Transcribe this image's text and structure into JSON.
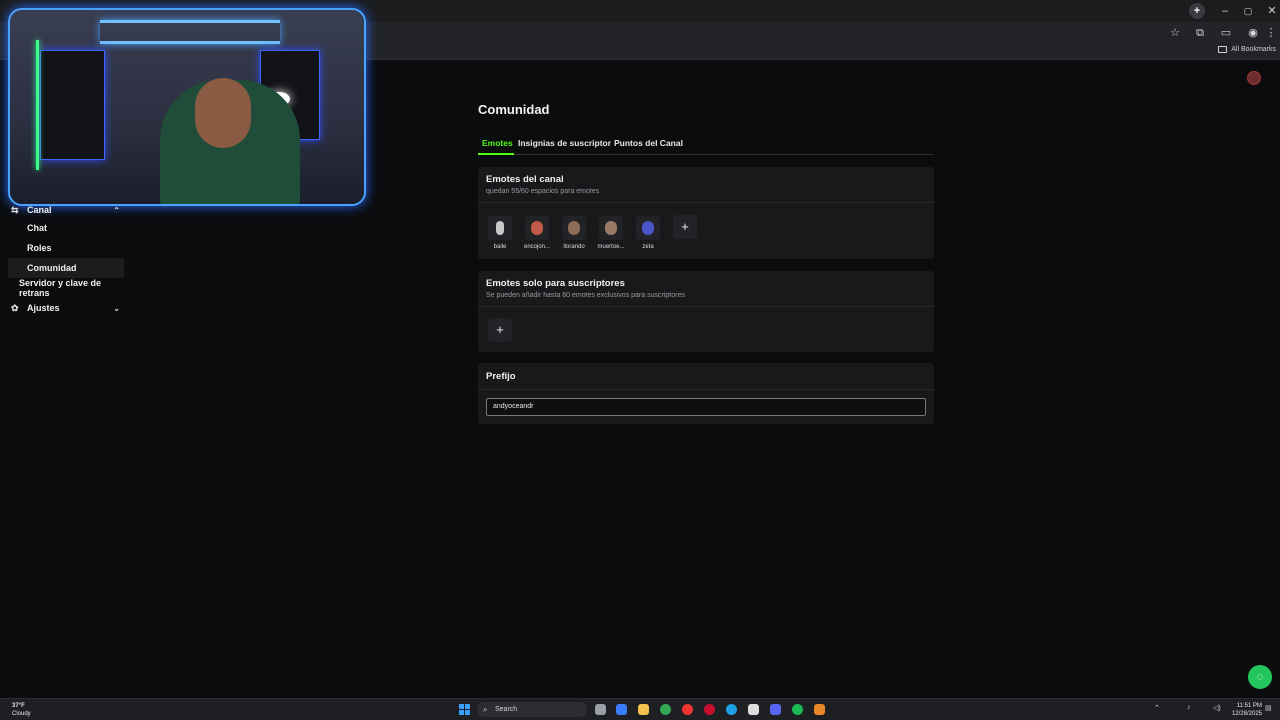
{
  "browser": {
    "bookmarks_label": "All Bookmarks"
  },
  "sidebar": {
    "items": [
      {
        "label": "Canal"
      },
      {
        "label": "Chat"
      },
      {
        "label": "Roles"
      },
      {
        "label": "Comunidad"
      },
      {
        "label": "Servidor y clave de retrans"
      },
      {
        "label": "Ajustes"
      }
    ]
  },
  "main": {
    "title": "Comunidad",
    "tabs": [
      {
        "label": "Emotes",
        "active": true
      },
      {
        "label": "Insignias de suscriptor"
      },
      {
        "label": "Puntos del Canal"
      }
    ],
    "channel_emotes": {
      "title": "Emotes del canal",
      "subtitle": "quedan 55/60 espacios para emotes",
      "emotes": [
        {
          "name": "baile"
        },
        {
          "name": "encojon..."
        },
        {
          "name": "llorando"
        },
        {
          "name": "muertoe..."
        },
        {
          "name": "zeta"
        }
      ],
      "add_label": "+"
    },
    "sub_emotes": {
      "title": "Emotes solo para suscriptores",
      "subtitle": "Se pueden añadir hasta 60 emotes exclusivos para suscriptores",
      "add_label": "+"
    },
    "prefix": {
      "title": "Prefijo",
      "value": "andyoceandr"
    }
  },
  "taskbar": {
    "temperature": "37°F",
    "weather": "Cloudy",
    "search_label": "Search",
    "time": "11:51 PM",
    "date": "12/28/2025"
  },
  "colors": {
    "accent": "#53fc18",
    "background": "#0b0c0d",
    "card": "#18191b"
  }
}
